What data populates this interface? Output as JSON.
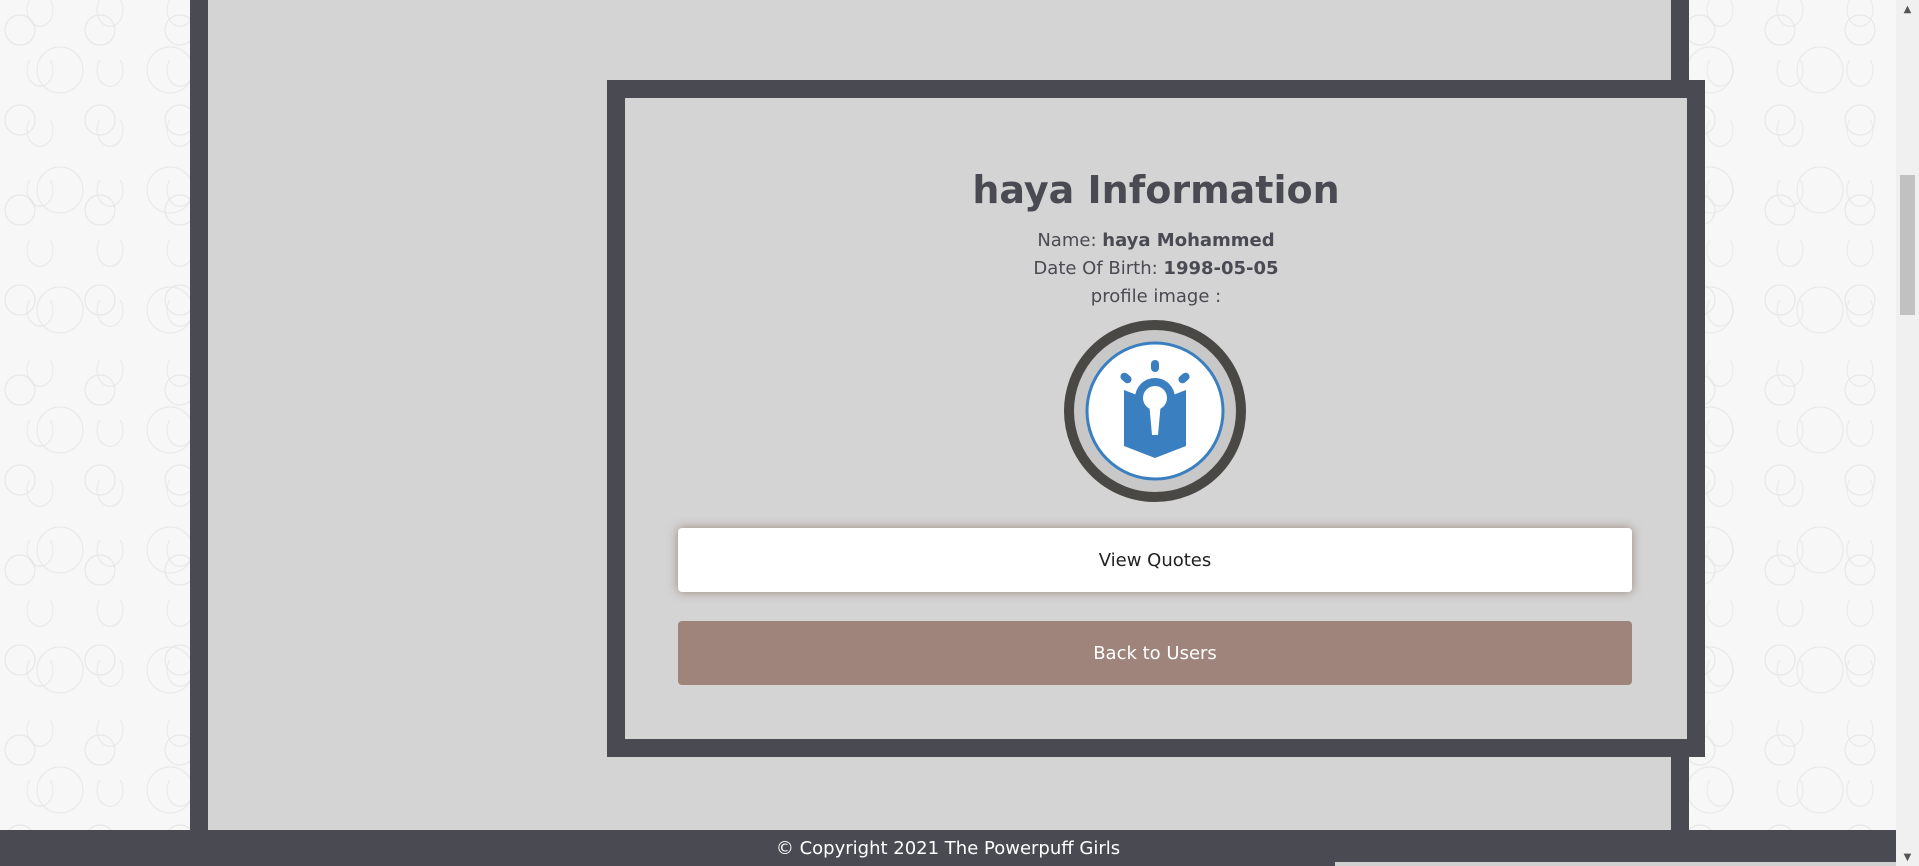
{
  "profile": {
    "title": "haya Information",
    "name_label": "Name:",
    "name_value": "haya Mohammed",
    "dob_label": "Date Of Birth:",
    "dob_value": "1998-05-05",
    "image_label": "profile image :",
    "image_icon": "book-lamp-logo-icon"
  },
  "actions": {
    "view_quotes_label": "View Quotes",
    "back_label": "Back to Users"
  },
  "footer": {
    "copyright": "© Copyright 2021 The Powerpuff Girls"
  },
  "colors": {
    "frame": "#4a4a52",
    "panel": "#d4d4d4",
    "back_button": "#9e847a",
    "logo_blue": "#3a7fc0"
  }
}
